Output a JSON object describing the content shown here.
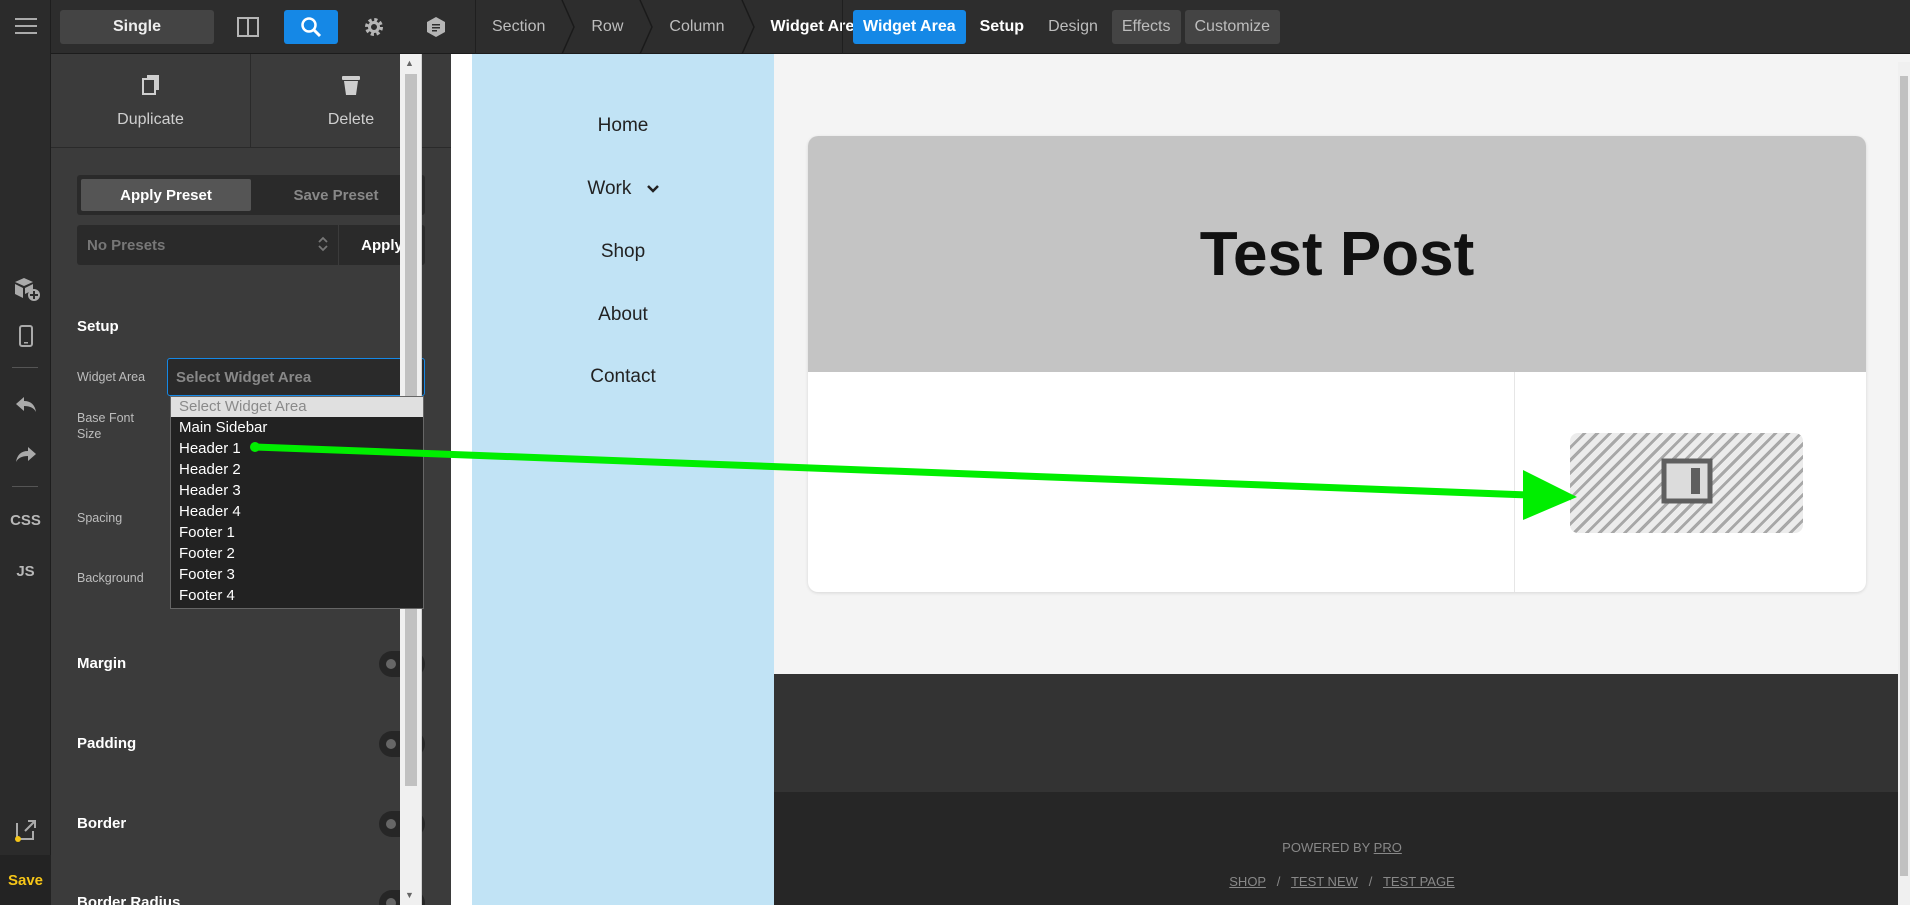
{
  "rail": {
    "css_label": "CSS",
    "js_label": "JS",
    "save_label": "Save"
  },
  "topbar": {
    "mode_label": "Single",
    "breadcrumbs": [
      "Section",
      "Row",
      "Column",
      "Widget Area"
    ],
    "tabs": [
      "Widget Area",
      "Setup",
      "Design",
      "Effects",
      "Customize"
    ],
    "accent": "#1588e6"
  },
  "inspector": {
    "duplicate_label": "Duplicate",
    "delete_label": "Delete",
    "apply_preset_label": "Apply Preset",
    "save_preset_label": "Save Preset",
    "preset_select_value": "No Presets",
    "apply_label": "Apply",
    "setup_title": "Setup",
    "widget_area_label": "Widget Area",
    "widget_area_value": "Select Widget Area",
    "base_font_size_label": "Base Font Size",
    "spacing_label": "Spacing",
    "background_label": "Background",
    "dropdown_options": [
      "Select Widget Area",
      "Main Sidebar",
      "Header 1",
      "Header 2",
      "Header 3",
      "Header 4",
      "Footer 1",
      "Footer 2",
      "Footer 3",
      "Footer 4"
    ],
    "toggles": [
      {
        "label": "Margin",
        "on": false
      },
      {
        "label": "Padding",
        "on": false
      },
      {
        "label": "Border",
        "on": false
      },
      {
        "label": "Border Radius",
        "on": false
      }
    ]
  },
  "preview": {
    "nav_items": [
      "Home",
      "Work",
      "Shop",
      "About",
      "Contact"
    ],
    "post_title": "Test Post",
    "powered_by_prefix": "POWERED BY",
    "powered_by_link": "PRO",
    "footer_links": [
      "SHOP",
      "TEST NEW",
      "TEST PAGE"
    ],
    "footer_separator": "/",
    "nav_bg": "#c1e3f5",
    "arrow_color": "#00ff00"
  }
}
